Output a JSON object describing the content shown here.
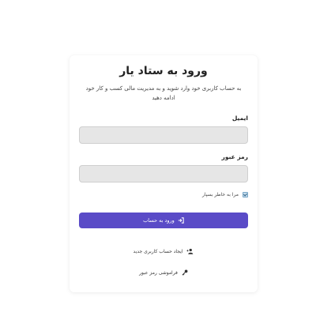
{
  "login": {
    "title": "ورود به ستاد یار",
    "subtitle": "به حساب کاربری خود وارد شوید و به مدیریت مالی کسب و کار خود ادامه دهید",
    "email_label": "ایمیل",
    "email_value": "",
    "password_label": "رمز عبور",
    "password_value": "",
    "remember_label": "مرا به خاطر بسپار",
    "remember_checked": true,
    "submit_label": "ورود به حساب",
    "create_account_label": "ایجاد حساب کاربری جدید",
    "forgot_password_label": "فراموشی رمز عبور"
  },
  "colors": {
    "primary": "#5a4bc7",
    "input_bg": "#e6e6e6"
  },
  "icons": {
    "submit": "sign-in-icon",
    "create_account": "user-plus-icon",
    "forgot_password": "key-icon"
  }
}
